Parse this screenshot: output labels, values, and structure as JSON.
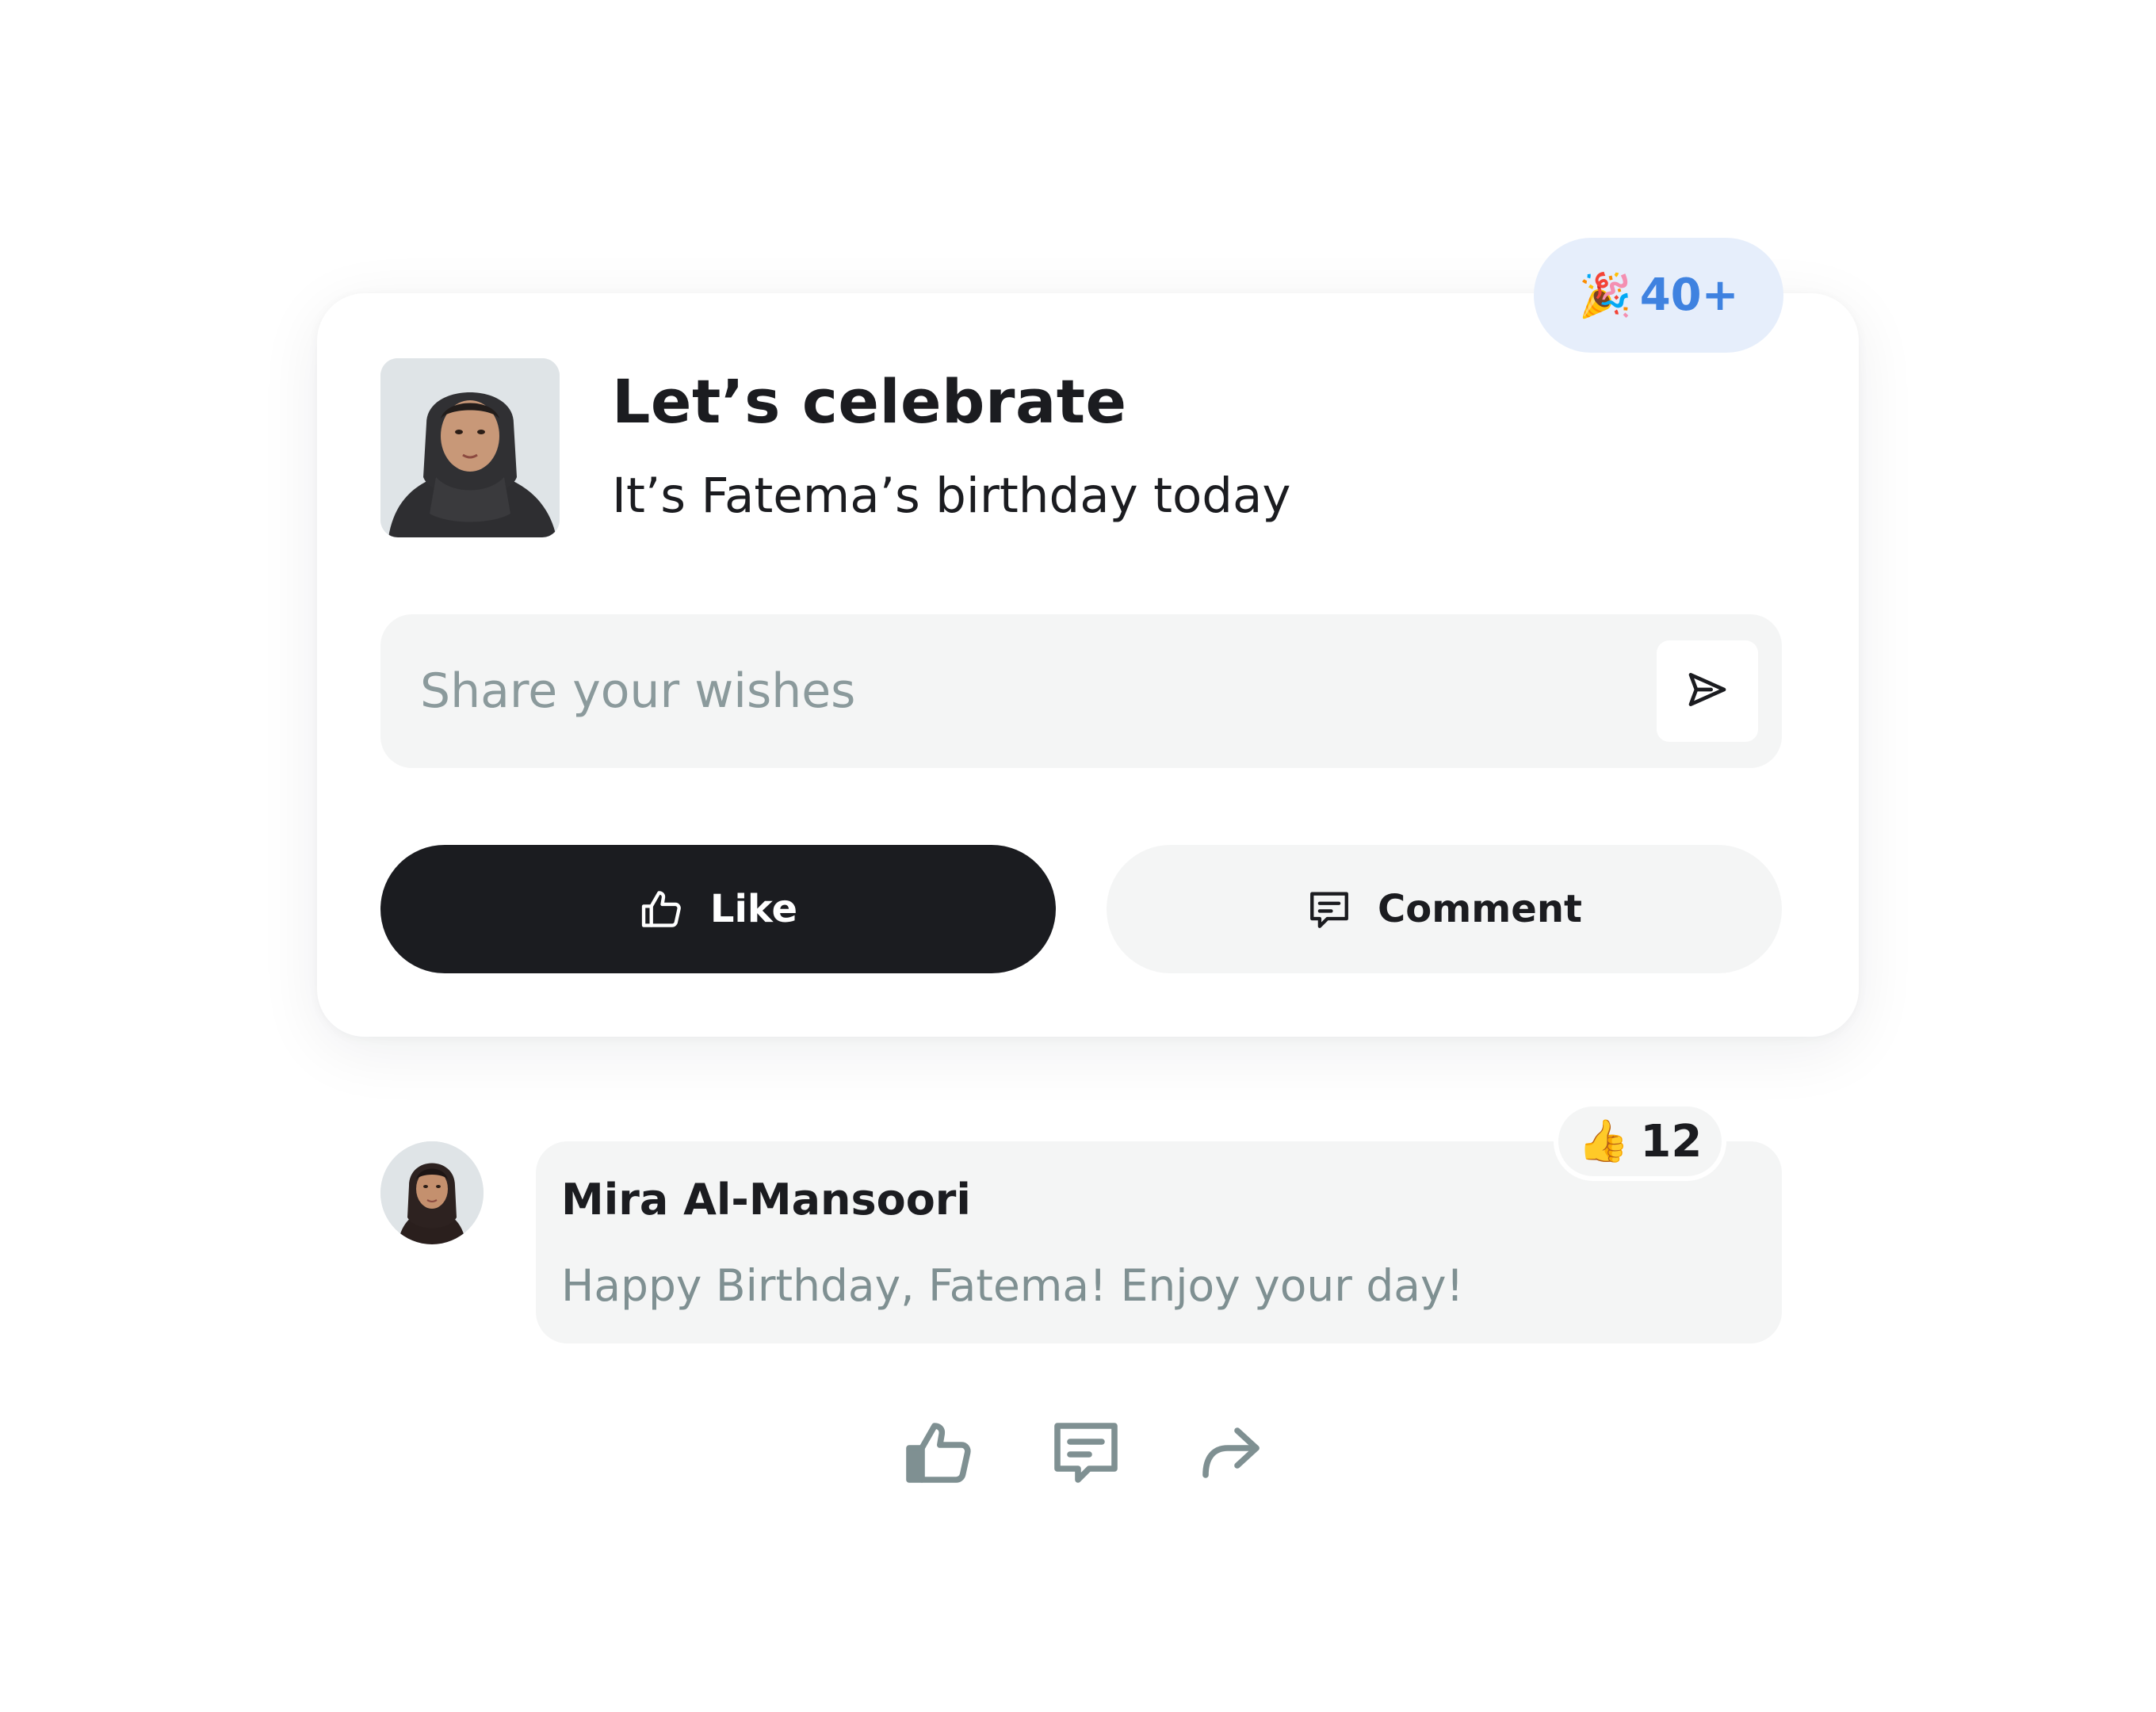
{
  "card": {
    "badge": {
      "emoji": "🎉",
      "count": "40+"
    },
    "title": "Let’s celebrate",
    "subtitle": "It’s Fatema’s birthday today",
    "wish_input": {
      "placeholder": "Share your wishes",
      "value": ""
    },
    "like_label": "Like",
    "comment_label": "Comment"
  },
  "comment": {
    "author": "Mira Al-Mansoori",
    "text": "Happy Birthday, Fatema! Enjoy your day!",
    "reaction": {
      "emoji": "👍",
      "count": "12"
    }
  },
  "icons": {
    "badge": "party-popper-icon",
    "send": "send-icon",
    "like": "thumbs-up-icon",
    "comment": "comment-icon",
    "share": "share-icon"
  },
  "colors": {
    "dark_button": "#1b1c20",
    "badge_bg": "#e6eefb",
    "badge_text": "#3f82e0",
    "muted_text": "#7f9092",
    "surface": "#f4f5f5"
  }
}
